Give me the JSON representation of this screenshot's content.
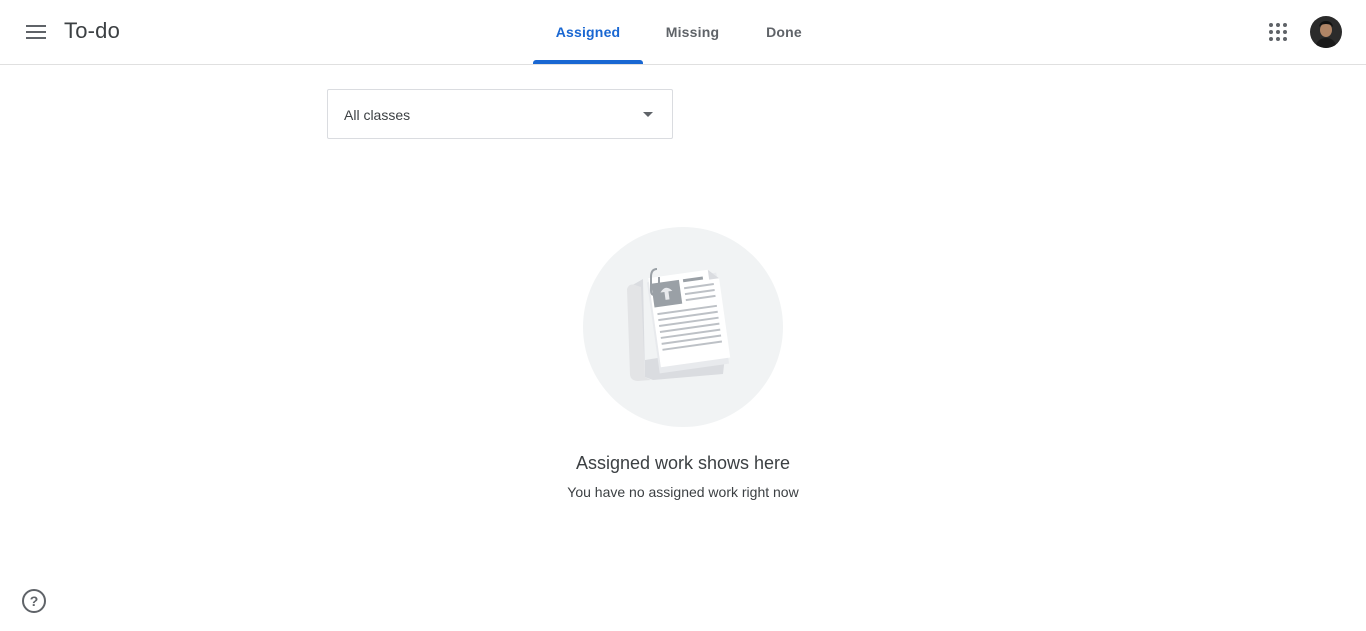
{
  "header": {
    "title": "To-do",
    "menu_icon": "hamburger-menu-icon",
    "apps_icon": "apps-grid-icon",
    "avatar_icon": "account-avatar"
  },
  "tabs": [
    {
      "label": "Assigned",
      "active": true
    },
    {
      "label": "Missing",
      "active": false
    },
    {
      "label": "Done",
      "active": false
    }
  ],
  "filter": {
    "selected": "All classes",
    "icon": "dropdown-arrow-icon"
  },
  "empty_state": {
    "illustration": "document-illustration",
    "title": "Assigned work shows here",
    "subtitle": "You have no assigned work right now"
  },
  "footer": {
    "help_icon": "help-icon",
    "help_glyph": "?"
  },
  "colors": {
    "accent": "#1967d2",
    "text": "#3c4043",
    "muted": "#5f6368",
    "divider": "#e0e0e0"
  }
}
